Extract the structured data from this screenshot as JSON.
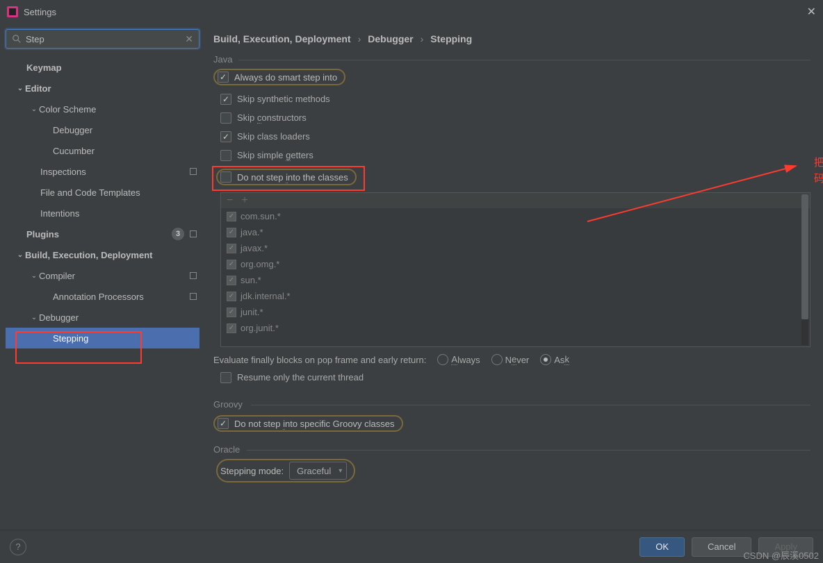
{
  "title": "Settings",
  "search": {
    "value": "Step"
  },
  "sidebar": {
    "keymap": "Keymap",
    "editor": "Editor",
    "color_scheme": "Color Scheme",
    "debugger": "Debugger",
    "cucumber": "Cucumber",
    "inspections": "Inspections",
    "file_templates": "File and Code Templates",
    "intentions": "Intentions",
    "plugins": "Plugins",
    "plugins_badge": "3",
    "bed": "Build, Execution, Deployment",
    "compiler": "Compiler",
    "annotation": "Annotation Processors",
    "debugger2": "Debugger",
    "stepping": "Stepping"
  },
  "breadcrumb": {
    "a": "Build, Execution, Deployment",
    "b": "Debugger",
    "c": "Stepping"
  },
  "java": {
    "head": "Java",
    "smart_step": "Always do smart step into",
    "skip_synth": "Skip synthetic methods",
    "skip_ctor": "Skip constructors",
    "skip_loaders": "Skip class loaders",
    "skip_getters": "Skip simple getters",
    "no_step_classes": "Do not step into the classes",
    "classes": [
      "com.sun.*",
      "java.*",
      "javax.*",
      "org.omg.*",
      "sun.*",
      "jdk.internal.*",
      "junit.*",
      "org.junit.*"
    ]
  },
  "eval": {
    "label": "Evaluate finally blocks on pop frame and early return:",
    "always": "Always",
    "never": "Never",
    "ask": "Ask",
    "resume": "Resume only the current thread"
  },
  "groovy": {
    "head": "Groovy",
    "no_step": "Do not step into specific Groovy classes"
  },
  "oracle": {
    "head": "Oracle",
    "mode_label": "Stepping mode:",
    "mode_value": "Graceful"
  },
  "annotation_text": "把这个取消  这样调试的时候就可以进入到源码里面",
  "watermark": "CSDN @辰溪0502",
  "buttons": {
    "ok": "OK",
    "cancel": "Cancel",
    "apply": "Apply"
  }
}
